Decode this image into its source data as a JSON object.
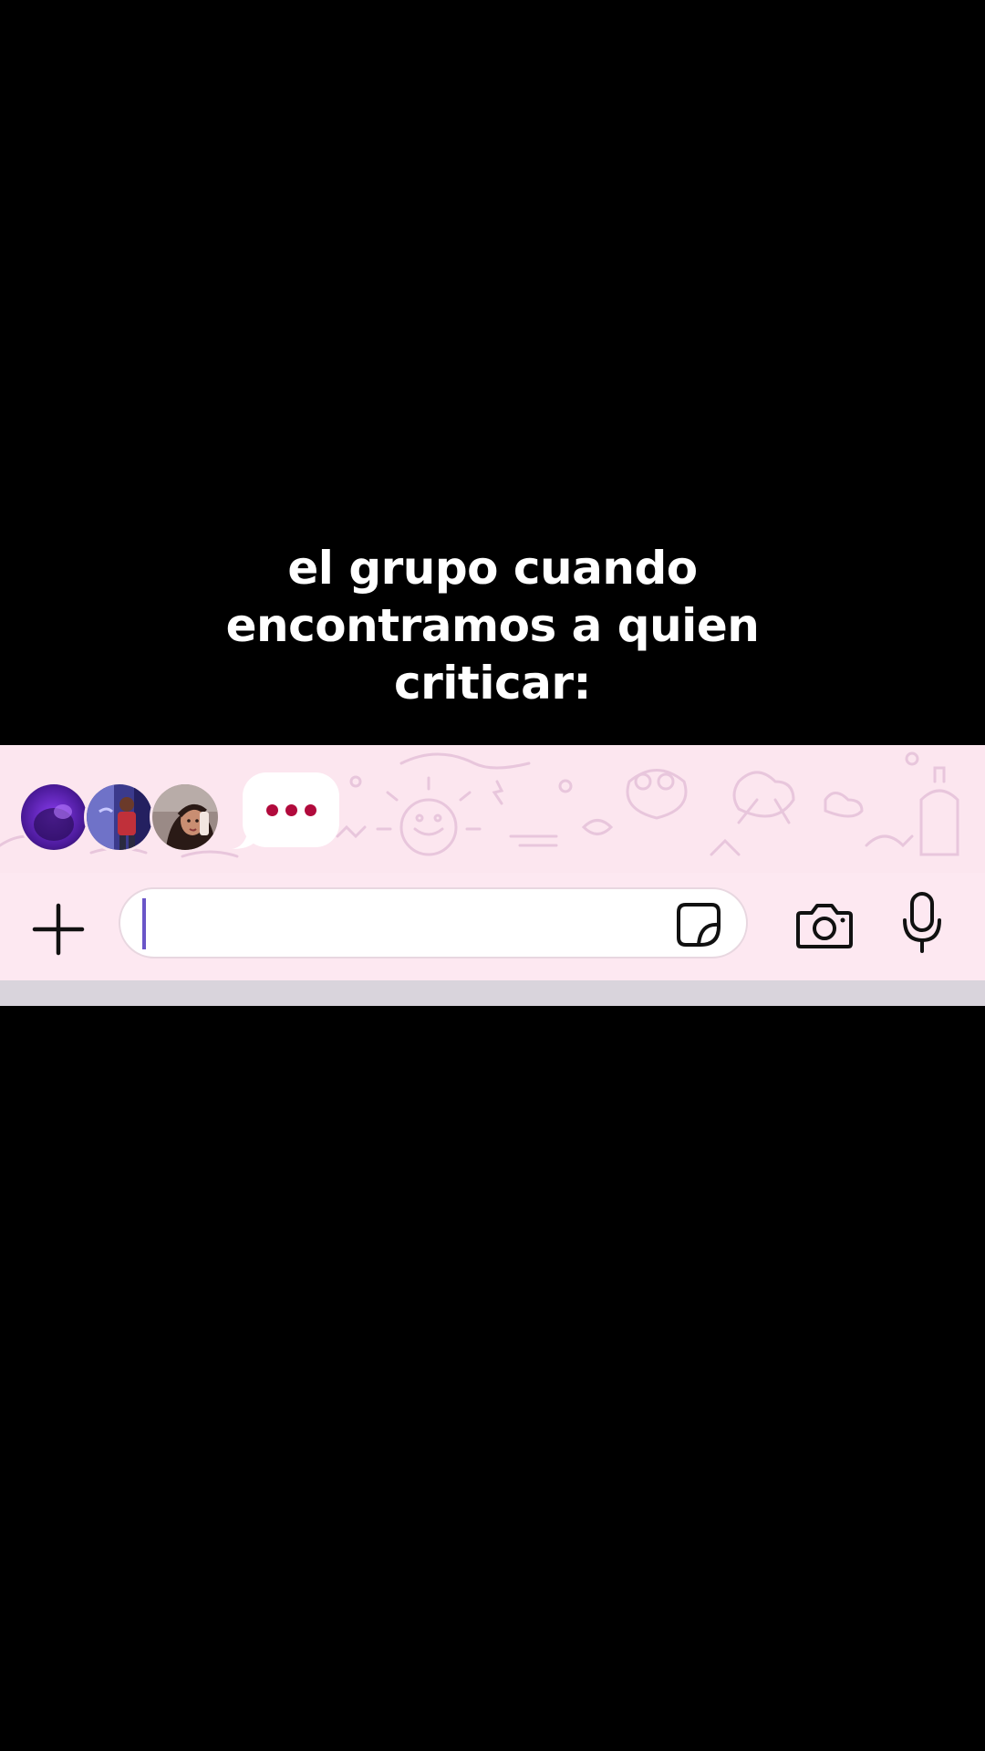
{
  "caption": {
    "lines": [
      "el grupo cuando",
      "encontramos a quien",
      "criticar:"
    ]
  },
  "chat": {
    "typing_indicator_icon": "typing-dots-icon",
    "participants": [
      {
        "name_icon": "avatar-1"
      },
      {
        "name_icon": "avatar-2"
      },
      {
        "name_icon": "avatar-3"
      }
    ],
    "colors": {
      "background": "#fce6ef",
      "typing_dots": "#b10a3c",
      "cursor": "#6a55c8"
    }
  },
  "composer": {
    "input_value": "",
    "icons": {
      "attach": "plus-icon",
      "sticker": "sticker-icon",
      "camera": "camera-icon",
      "voice": "microphone-icon"
    }
  }
}
